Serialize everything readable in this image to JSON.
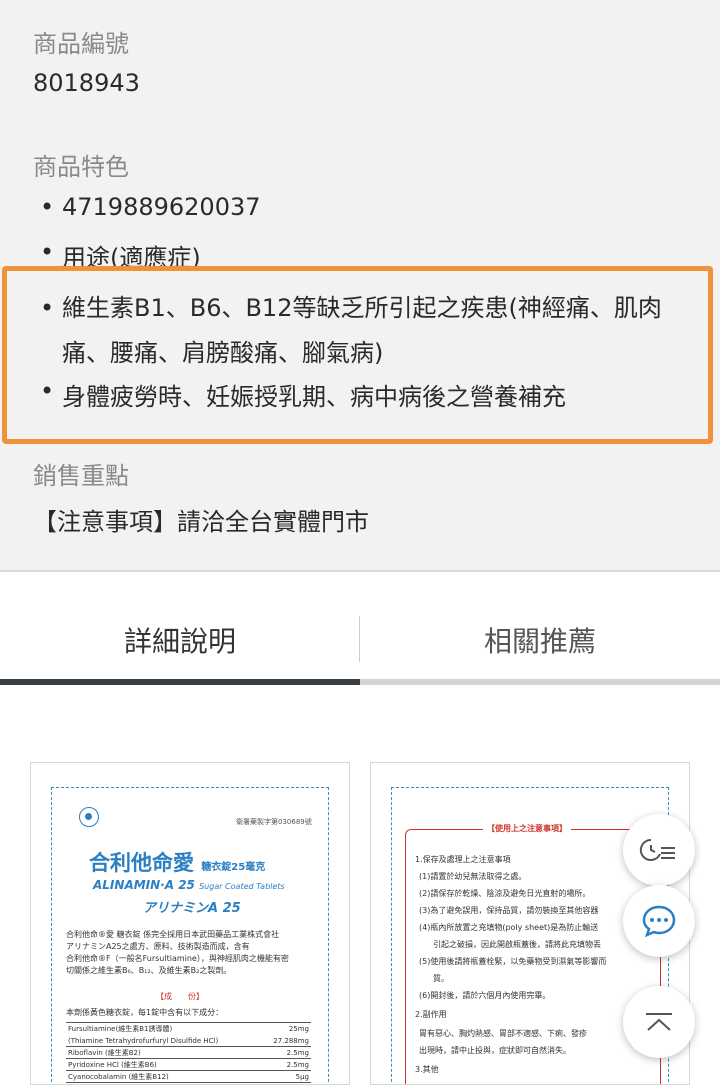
{
  "product": {
    "number_label": "商品編號",
    "number_value": "8018943",
    "features_label": "商品特色",
    "features": [
      "4719889620037",
      "用途(適應症)"
    ],
    "highlighted": [
      "維生素B1、B6、B12等缺乏所引起之疾患(神經痛、肌肉",
      "痛、腰痛、肩膀酸痛、腳氣病)",
      "身體疲勞時、妊娠授乳期、病中病後之營養補充"
    ],
    "sales_label": "銷售重點",
    "sales_value": "【注意事項】請洽全台實體門市"
  },
  "tabs": [
    {
      "label": "詳細說明"
    },
    {
      "label": "相關推薦"
    }
  ],
  "doc_left": {
    "reg_no": "衛署藥製字第030689號",
    "brand_cn": "合利他命",
    "brand_cn_suffix": "愛",
    "sugar_cn": "糖衣錠25毫克",
    "brand_en": "ALINAMIN·A 25",
    "brand_en_sub": "Sugar Coated Tablets",
    "brand_jp": "アリナミンA 25",
    "desc": [
      "合利他命®愛 糖衣錠 係完全採用日本武田藥品工業株式會社",
      "アリナミンA25之處方、原料、技術製造而成，含有",
      "合利他命®F（一般名Fursultiamine），與神經肌肉之機能有密",
      "切關係之維生素B₆、B₁₂、及維生素B₂之製劑。"
    ],
    "ingredient_title": "【成　　份】",
    "ingredient_intro": "本劑係黃色糖衣錠，每1錠中含有以下成分：",
    "ingredients": [
      {
        "name": "Fursultiamine(維生素B1誘導體)",
        "amount": "25mg"
      },
      {
        "name": "(Thiamine Tetrahydrofurfuryl Disulfide HCl)",
        "amount": "27.288mg"
      },
      {
        "name": "Riboflavin (維生素B2)",
        "amount": "2.5mg"
      },
      {
        "name": "Pyridoxine HCl (維生素B6)",
        "amount": "2.5mg"
      },
      {
        "name": "Cyanocobalamin (維生素B12)",
        "amount": "5μg"
      }
    ]
  },
  "doc_right": {
    "title": "【使用上之注意事項】",
    "lines": [
      "1.保存及處理上之注意事項",
      "(1)請置於幼兒無法取得之處。",
      "(2)請保存於乾燥、陰涼及避免日光直射的場所。",
      "(3)為了避免誤用，保持品質，請勿裝換至其他容器",
      "(4)瓶內所放置之充填物(poly sheet)是為防止輸送",
      "引起之破損，因此開啟瓶蓋後，請將此充填物丟",
      "(5)使用後請將瓶蓋栓緊，以免藥物受到濕氣等影響而",
      "質。",
      "(6)開封後，請於六個月內使用完畢。",
      "2.副作用",
      "胃有惡心、胸灼熱感、胃部不適感、下痢、發疹",
      "出現時，請中止投與，症狀即可自然消失。",
      "3.其他"
    ]
  },
  "fab": {
    "history_icon": "history-list-icon",
    "chat_icon": "chat-bubble-icon",
    "top_icon": "chevron-up-icon"
  },
  "colors": {
    "highlight_border": "#f0913d",
    "active_tab_bar": "#3a3f47",
    "accent_blue": "#2b7fc4",
    "doc_red": "#d0342c"
  }
}
